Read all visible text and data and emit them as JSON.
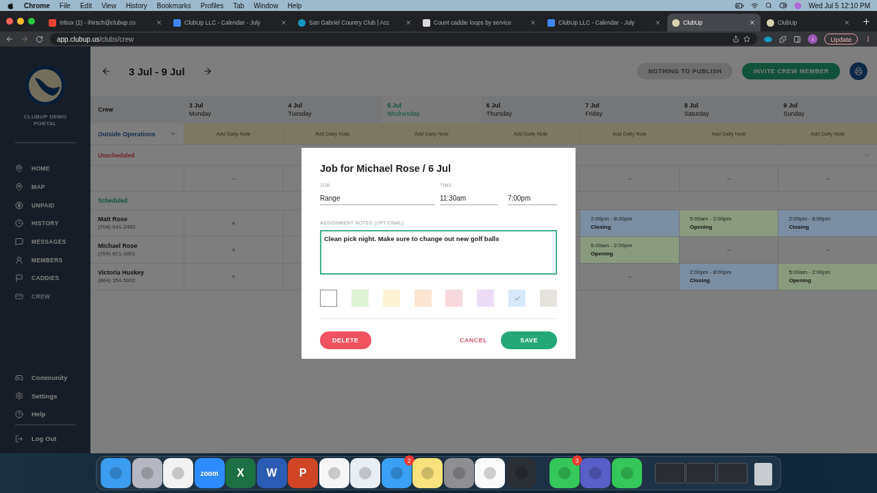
{
  "menubar": {
    "app": "Chrome",
    "menus": [
      "File",
      "Edit",
      "View",
      "History",
      "Bookmarks",
      "Profiles",
      "Tab",
      "Window",
      "Help"
    ],
    "clock": "Wed Jul 5  12:10 PM"
  },
  "tabs": [
    {
      "title": "Inbox (2) - ihirsch@clubup.co",
      "kind": "mail",
      "selected": false
    },
    {
      "title": "ClubUp LLC - Calendar - July",
      "kind": "calendar",
      "selected": false
    },
    {
      "title": "San Gabriel Country Club | Acc",
      "kind": "cloud",
      "selected": false
    },
    {
      "title": "Count caddie loops by service",
      "kind": "doc",
      "selected": false
    },
    {
      "title": "ClubUp LLC - Calendar - July",
      "kind": "calendar",
      "selected": false
    },
    {
      "title": "ClubUp",
      "kind": "clubup",
      "selected": true
    },
    {
      "title": "ClubUp",
      "kind": "clubup",
      "selected": false
    }
  ],
  "address": {
    "host": "app.clubup.us",
    "path": "/clubs/crew"
  },
  "profile_initial": "I",
  "update_button": "Update",
  "sidebar": {
    "portal": "CLUBUP DEMO PORTAL",
    "nav": [
      {
        "label": "HOME",
        "kind": "home",
        "selected": false
      },
      {
        "label": "MAP",
        "kind": "map",
        "selected": false
      },
      {
        "label": "UNPAID",
        "kind": "unpaid",
        "selected": false
      },
      {
        "label": "HISTORY",
        "kind": "history",
        "selected": false
      },
      {
        "label": "MESSAGES",
        "kind": "messages",
        "selected": false
      },
      {
        "label": "MEMBERS",
        "kind": "members",
        "selected": false
      },
      {
        "label": "CADDIES",
        "kind": "caddies",
        "selected": false
      },
      {
        "label": "CREW",
        "kind": "crew",
        "selected": true
      }
    ],
    "footer": [
      {
        "label": "Community",
        "kind": "community"
      },
      {
        "label": "Settings",
        "kind": "settings"
      },
      {
        "label": "Help",
        "kind": "help"
      },
      {
        "label": "Log Out",
        "kind": "logout"
      }
    ]
  },
  "schedule": {
    "range": "3 Jul - 9 Jul",
    "publish_button": {
      "label": "NOTHING TO PUBLISH",
      "disabled": true
    },
    "invite_button": "INVITE CREW MEMBER",
    "crew_heading": "Crew",
    "days": [
      {
        "date": "3 Jul",
        "weekday": "Monday",
        "selected": false
      },
      {
        "date": "4 Jul",
        "weekday": "Tuesday",
        "selected": false
      },
      {
        "date": "5 Jul",
        "weekday": "Wednesday",
        "selected": true
      },
      {
        "date": "6 Jul",
        "weekday": "Thursday",
        "selected": false
      },
      {
        "date": "7 Jul",
        "weekday": "Friday",
        "selected": false
      },
      {
        "date": "8 Jul",
        "weekday": "Saturday",
        "selected": false
      },
      {
        "date": "9 Jul",
        "weekday": "Sunday",
        "selected": false
      }
    ],
    "group": {
      "name": "Outside Operations",
      "expanded": true,
      "notes": [
        "Add Daily Note",
        "Add Daily Note",
        "Add Daily Note",
        "Add Daily Note",
        "Add Daily Note",
        "Add Daily Note",
        "Add Daily Note"
      ]
    },
    "sections": [
      {
        "title": "Unscheduled",
        "kind": "unscheduled",
        "expanded": true,
        "rows": [
          {
            "cells": [
              {
                "kind": "mark",
                "text": "–"
              },
              null,
              null,
              null,
              {
                "kind": "mark",
                "text": "–"
              },
              {
                "kind": "mark",
                "text": "–"
              },
              {
                "kind": "mark",
                "text": "–"
              }
            ]
          }
        ]
      },
      {
        "title": "Scheduled",
        "kind": "scheduled",
        "rows": [
          {
            "name": "Matt Rose",
            "phone": "(704) 641-2450",
            "cells": [
              {
                "kind": "mark",
                "text": "×"
              },
              null,
              null,
              null,
              {
                "kind": "shift",
                "time": "2:00pm - 8:00pm",
                "job": "Closing",
                "color": "#7b8da0"
              },
              {
                "kind": "shift",
                "time": "5:00am - 2:00pm",
                "job": "Opening",
                "color": "#8a9a7e"
              },
              {
                "kind": "shift",
                "time": "2:00pm - 8:00pm",
                "job": "Closing",
                "color": "#7b8da0"
              }
            ]
          },
          {
            "name": "Michael Rose",
            "phone": "(704) 621-1001",
            "cells": [
              {
                "kind": "mark",
                "text": "×"
              },
              null,
              null,
              null,
              {
                "kind": "shift",
                "time": "5:00am - 2:00pm",
                "job": "Opening",
                "color": "#8a9a7e"
              },
              {
                "kind": "mark",
                "text": "–"
              },
              {
                "kind": "mark",
                "text": "–"
              }
            ]
          },
          {
            "name": "Victoria Huskey",
            "phone": "(864) 354-5002",
            "cells": [
              {
                "kind": "mark",
                "text": "×"
              },
              null,
              null,
              null,
              {
                "kind": "mark",
                "text": "–"
              },
              {
                "kind": "shift",
                "time": "2:00pm - 8:00pm",
                "job": "Closing",
                "color": "#7b8da0"
              },
              {
                "kind": "shift",
                "time": "5:00am - 2:00pm",
                "job": "Opening",
                "color": "#8a9a7e"
              }
            ]
          }
        ]
      }
    ]
  },
  "modal": {
    "title": "Job for Michael Rose / 6 Jul",
    "job_label": "JOB",
    "job": "Range",
    "time_label": "TIME",
    "start": "11:30am",
    "end": "7:00pm",
    "notes_label": "ASSIGNMENT NOTES (OPTIONAL)",
    "notes": "Clean pick night. Make sure to change out new golf balls",
    "swatches": [
      {
        "color": "#ffffff",
        "selected": false
      },
      {
        "color": "#def2d6",
        "selected": false
      },
      {
        "color": "#fbf3d3",
        "selected": false
      },
      {
        "color": "#fbe4d2",
        "selected": false
      },
      {
        "color": "#f7d8dd",
        "selected": false
      },
      {
        "color": "#ecdcf6",
        "selected": false
      },
      {
        "color": "#d8e8fb",
        "selected": true
      },
      {
        "color": "#e6e3df",
        "selected": false
      }
    ],
    "delete": "DELETE",
    "cancel": "CANCEL",
    "save": "SAVE"
  },
  "dock": [
    {
      "kind": "finder"
    },
    {
      "kind": "grid"
    },
    {
      "kind": "chrome"
    },
    {
      "kind": "zoom",
      "label": "zoom"
    },
    {
      "kind": "excel",
      "label": "X"
    },
    {
      "kind": "word",
      "label": "W"
    },
    {
      "kind": "powerpoint",
      "label": "P"
    },
    {
      "kind": "slack"
    },
    {
      "kind": "safari"
    },
    {
      "kind": "mail",
      "badge": "2"
    },
    {
      "kind": "notes"
    },
    {
      "kind": "settings"
    },
    {
      "kind": "reminders"
    },
    {
      "kind": "quicktime"
    },
    {
      "kind": "divider"
    },
    {
      "kind": "messages",
      "badge": "3"
    },
    {
      "kind": "teams"
    },
    {
      "kind": "facetime"
    },
    {
      "kind": "divider"
    },
    {
      "kind": "window"
    },
    {
      "kind": "window"
    },
    {
      "kind": "window"
    },
    {
      "kind": "trash"
    }
  ]
}
